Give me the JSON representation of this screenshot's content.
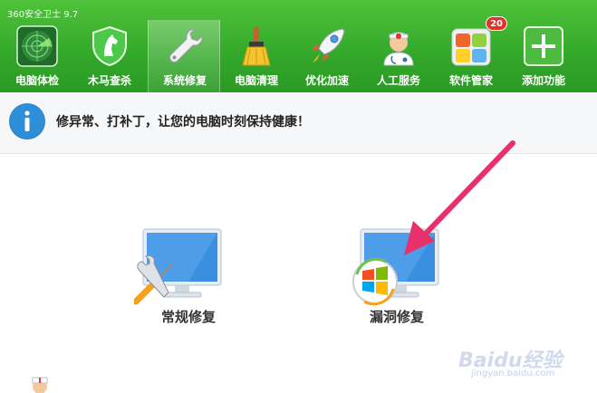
{
  "app": {
    "title": "360安全卫士 9.7"
  },
  "nav": {
    "items": [
      {
        "label": "电脑体检",
        "icon": "radar-icon"
      },
      {
        "label": "木马查杀",
        "icon": "horse-shield-icon"
      },
      {
        "label": "系统修复",
        "icon": "wrench-icon",
        "active": true
      },
      {
        "label": "电脑清理",
        "icon": "broom-icon"
      },
      {
        "label": "优化加速",
        "icon": "rocket-icon"
      },
      {
        "label": "人工服务",
        "icon": "doctor-icon"
      },
      {
        "label": "软件管家",
        "icon": "apps-icon",
        "badge": "20"
      },
      {
        "label": "添加功能",
        "icon": "plus-icon"
      }
    ]
  },
  "info": {
    "text": "修异常、打补丁，让您的电脑时刻保持健康！",
    "icon": "info-icon"
  },
  "repairs": {
    "normal": {
      "label": "常规修复",
      "icon": "tools-monitor-icon"
    },
    "patch": {
      "label": "漏洞修复",
      "icon": "windows-monitor-icon"
    }
  },
  "watermark": {
    "logo": "Baidu经验",
    "site": "jingyan.baidu.com"
  },
  "colors": {
    "top_green": "#36ab2c",
    "info_blue": "#2f8ed8",
    "arrow_pink": "#e8316b",
    "monitor_blue": "#3a8fe0"
  }
}
